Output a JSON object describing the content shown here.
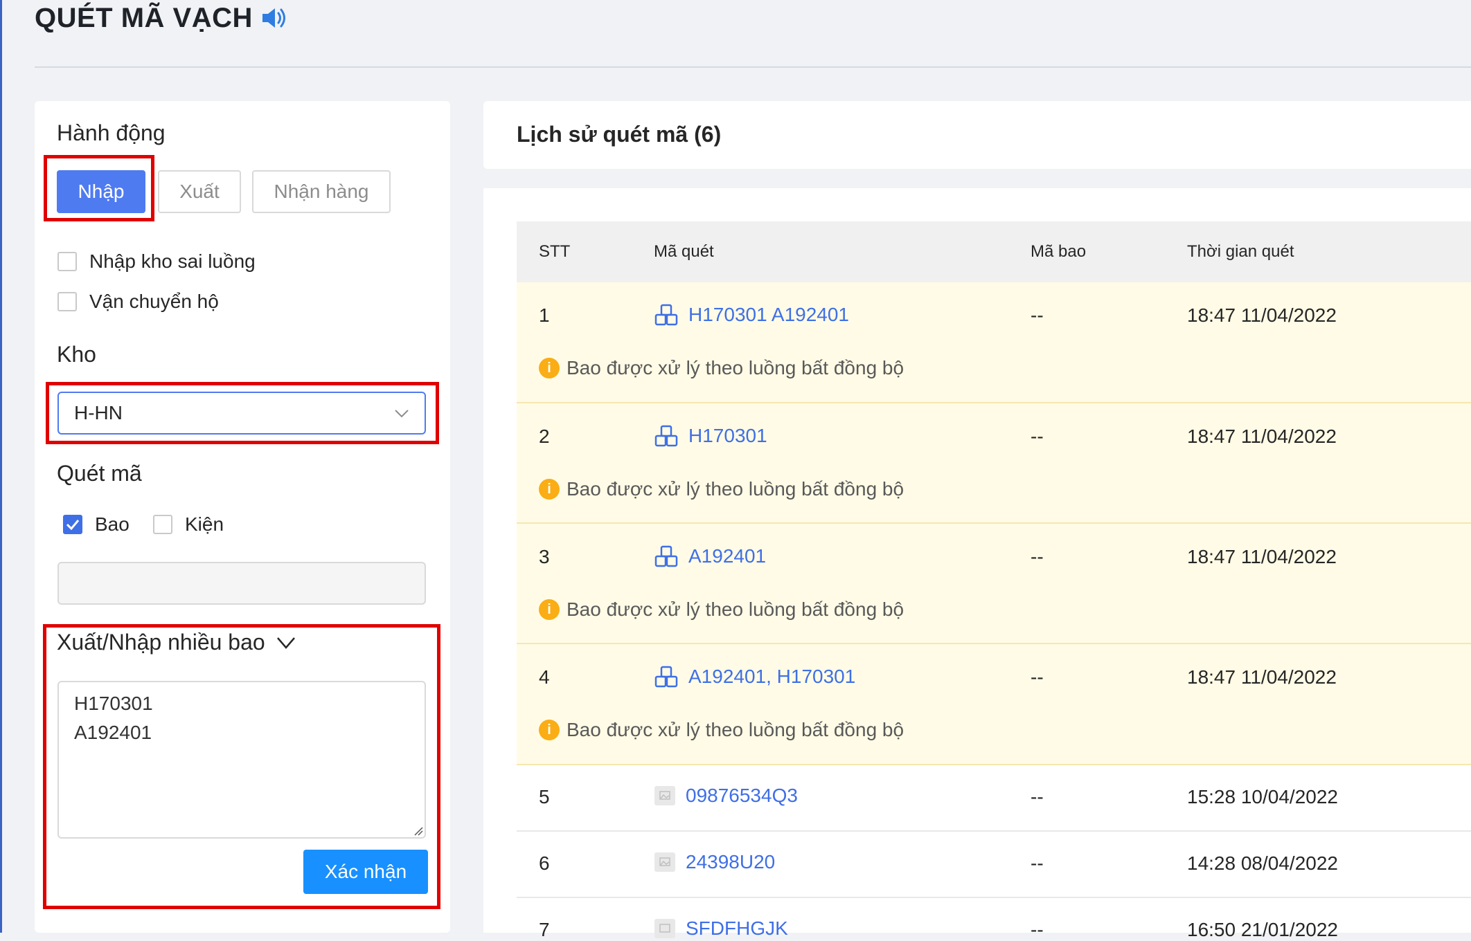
{
  "header": {
    "title": "QUÉT MÃ VẠCH"
  },
  "actions": {
    "label": "Hành động",
    "buttons": {
      "import": "Nhập",
      "export": "Xuất",
      "receive": "Nhận hàng"
    },
    "options": {
      "wrong_flow": "Nhập kho sai luồng",
      "ship_on_behalf": "Vận chuyển hộ"
    }
  },
  "warehouse": {
    "label": "Kho",
    "selected": "H-HN"
  },
  "scan": {
    "label": "Quét mã",
    "types": {
      "bag": "Bao",
      "package": "Kiện"
    },
    "bag_checked": true,
    "package_checked": false,
    "input_value": ""
  },
  "multi": {
    "label": "Xuất/Nhập nhiều bao",
    "lines": [
      "H170301",
      "A192401"
    ],
    "confirm_label": "Xác nhận"
  },
  "history": {
    "title": "Lịch sử quét mã (6)",
    "columns": {
      "stt": "STT",
      "code": "Mã quét",
      "bag": "Mã bao",
      "time": "Thời gian quét"
    },
    "rows": [
      {
        "stt": "1",
        "code": "H170301 A192401",
        "bag": "--",
        "time": "18:47 11/04/2022",
        "note": "Bao được xử lý theo luồng bất đồng bộ"
      },
      {
        "stt": "2",
        "code": "H170301",
        "bag": "--",
        "time": "18:47 11/04/2022",
        "note": "Bao được xử lý theo luồng bất đồng bộ"
      },
      {
        "stt": "3",
        "code": "A192401",
        "bag": "--",
        "time": "18:47 11/04/2022",
        "note": "Bao được xử lý theo luồng bất đồng bộ"
      },
      {
        "stt": "4",
        "code": "A192401, H170301",
        "bag": "--",
        "time": "18:47 11/04/2022",
        "note": "Bao được xử lý theo luồng bất đồng bộ"
      },
      {
        "stt": "5",
        "code": "09876534Q3",
        "bag": "--",
        "time": "15:28 10/04/2022"
      },
      {
        "stt": "6",
        "code": "24398U20",
        "bag": "--",
        "time": "14:28 08/04/2022"
      },
      {
        "stt": "7",
        "code": "SFDFHGJK",
        "bag": "--",
        "time": "16:50 21/01/2022"
      }
    ]
  },
  "colors": {
    "primary": "#4f7bf1",
    "highlight_border": "#e00000",
    "warning_bg": "#fffbe6",
    "link": "#3f6fe6",
    "warn_icon": "#faad14"
  },
  "icons": {
    "sound": "sound-icon",
    "bag_row": "boxes-icon",
    "image_row": "image-icon",
    "warning": "info-icon"
  }
}
